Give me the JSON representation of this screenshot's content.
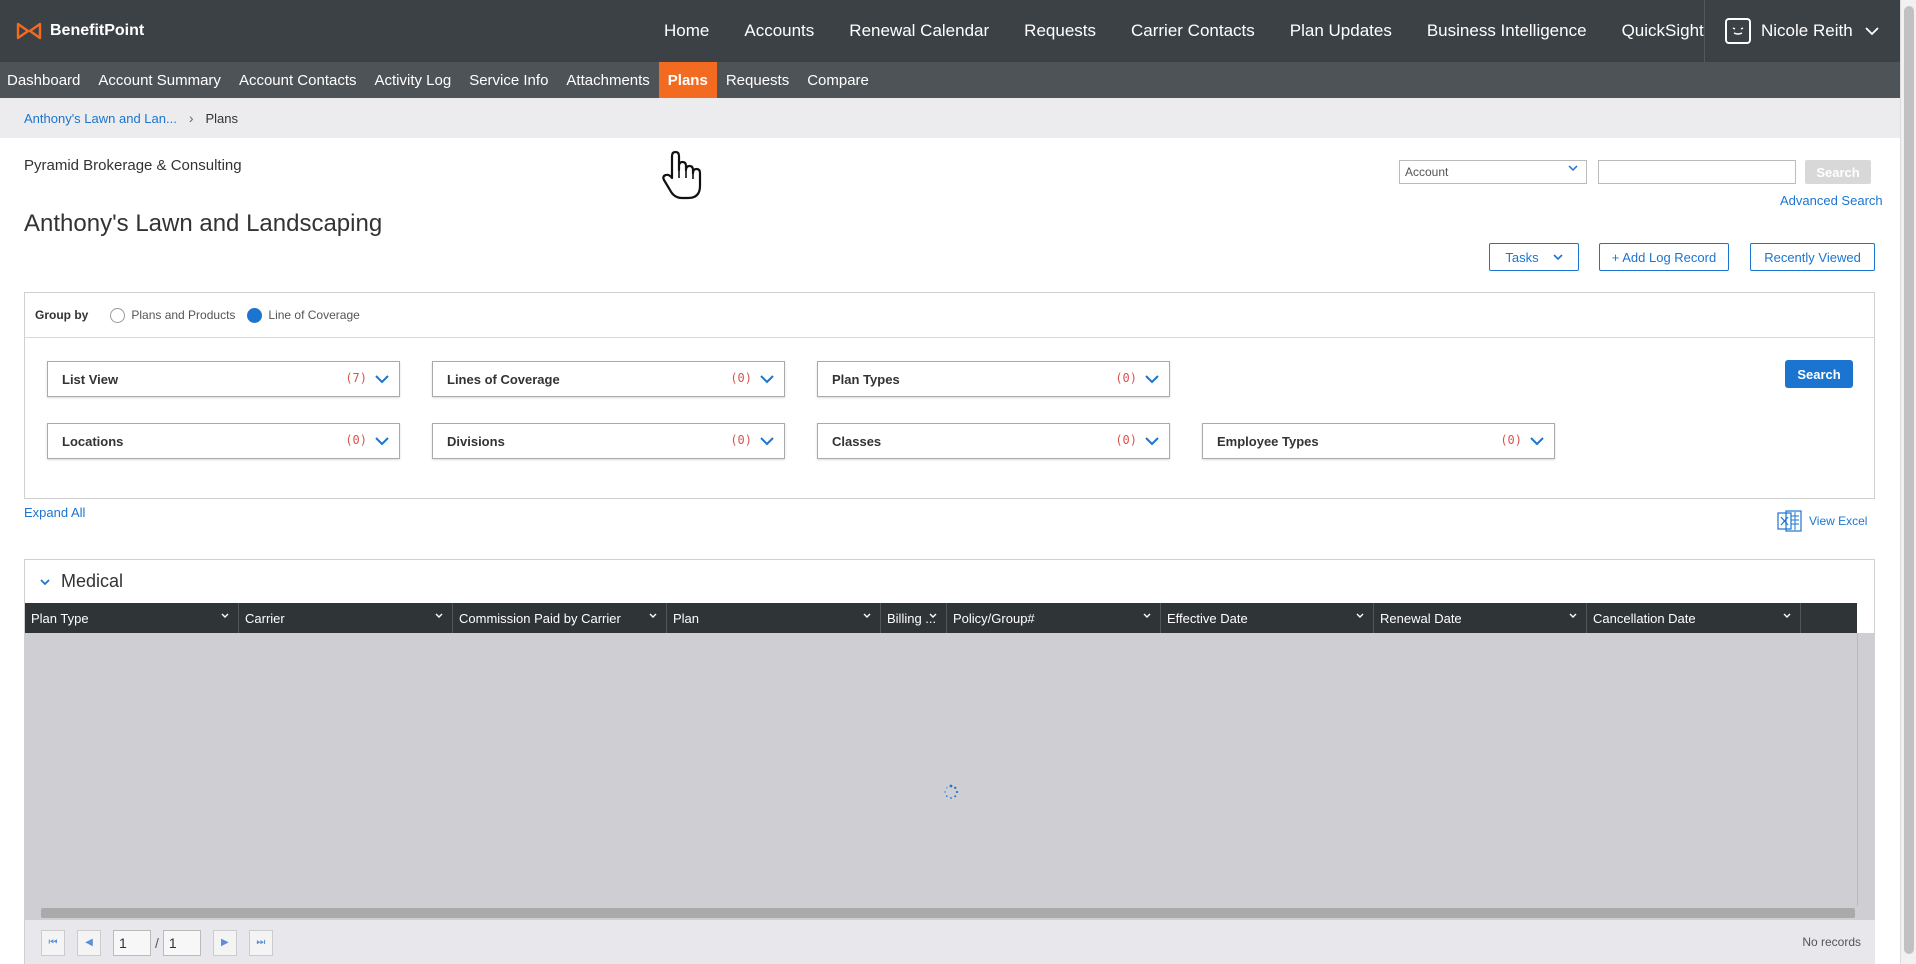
{
  "app": {
    "name": "BenefitPoint",
    "brand_color": "#f26b21"
  },
  "topnav": {
    "items": [
      "Home",
      "Accounts",
      "Renewal Calendar",
      "Requests",
      "Carrier Contacts",
      "Plan Updates",
      "Business Intelligence",
      "QuickSight"
    ],
    "user": "Nicole Reith"
  },
  "subnav": {
    "items": [
      "Dashboard",
      "Account Summary",
      "Account Contacts",
      "Activity Log",
      "Service Info",
      "Attachments",
      "Plans",
      "Requests",
      "Compare"
    ],
    "active": "Plans"
  },
  "breadcrumb": {
    "parent": "Anthony's Lawn and Lan...",
    "current": "Plans"
  },
  "header": {
    "org": "Pyramid Brokerage & Consulting",
    "title": "Anthony's Lawn and Landscaping"
  },
  "search": {
    "type": "Account",
    "value": "",
    "button": "Search",
    "advanced": "Advanced Search"
  },
  "actions": {
    "tasks": "Tasks",
    "add_log": "+ Add Log Record",
    "recent": "Recently Viewed"
  },
  "groupby": {
    "label": "Group by",
    "options": [
      "Plans and Products",
      "Line of Coverage"
    ],
    "selected": "Line of Coverage"
  },
  "filters": [
    {
      "label": "List View",
      "count": "(7)"
    },
    {
      "label": "Lines of Coverage",
      "count": "(0)"
    },
    {
      "label": "Plan Types",
      "count": "(0)"
    },
    {
      "label": "Locations",
      "count": "(0)"
    },
    {
      "label": "Divisions",
      "count": "(0)"
    },
    {
      "label": "Classes",
      "count": "(0)"
    },
    {
      "label": "Employee Types",
      "count": "(0)"
    }
  ],
  "filter_search": "Search",
  "expand_all": "Expand All",
  "view_excel": "View Excel",
  "section": {
    "title": "Medical",
    "columns": [
      "Plan Type",
      "Carrier",
      "Commission Paid by Carrier",
      "Plan",
      "Billing ...",
      "Policy/Group#",
      "Effective Date",
      "Renewal Date",
      "Cancellation Date"
    ],
    "pager": {
      "page": "1",
      "total": "1",
      "status": "No records"
    }
  }
}
